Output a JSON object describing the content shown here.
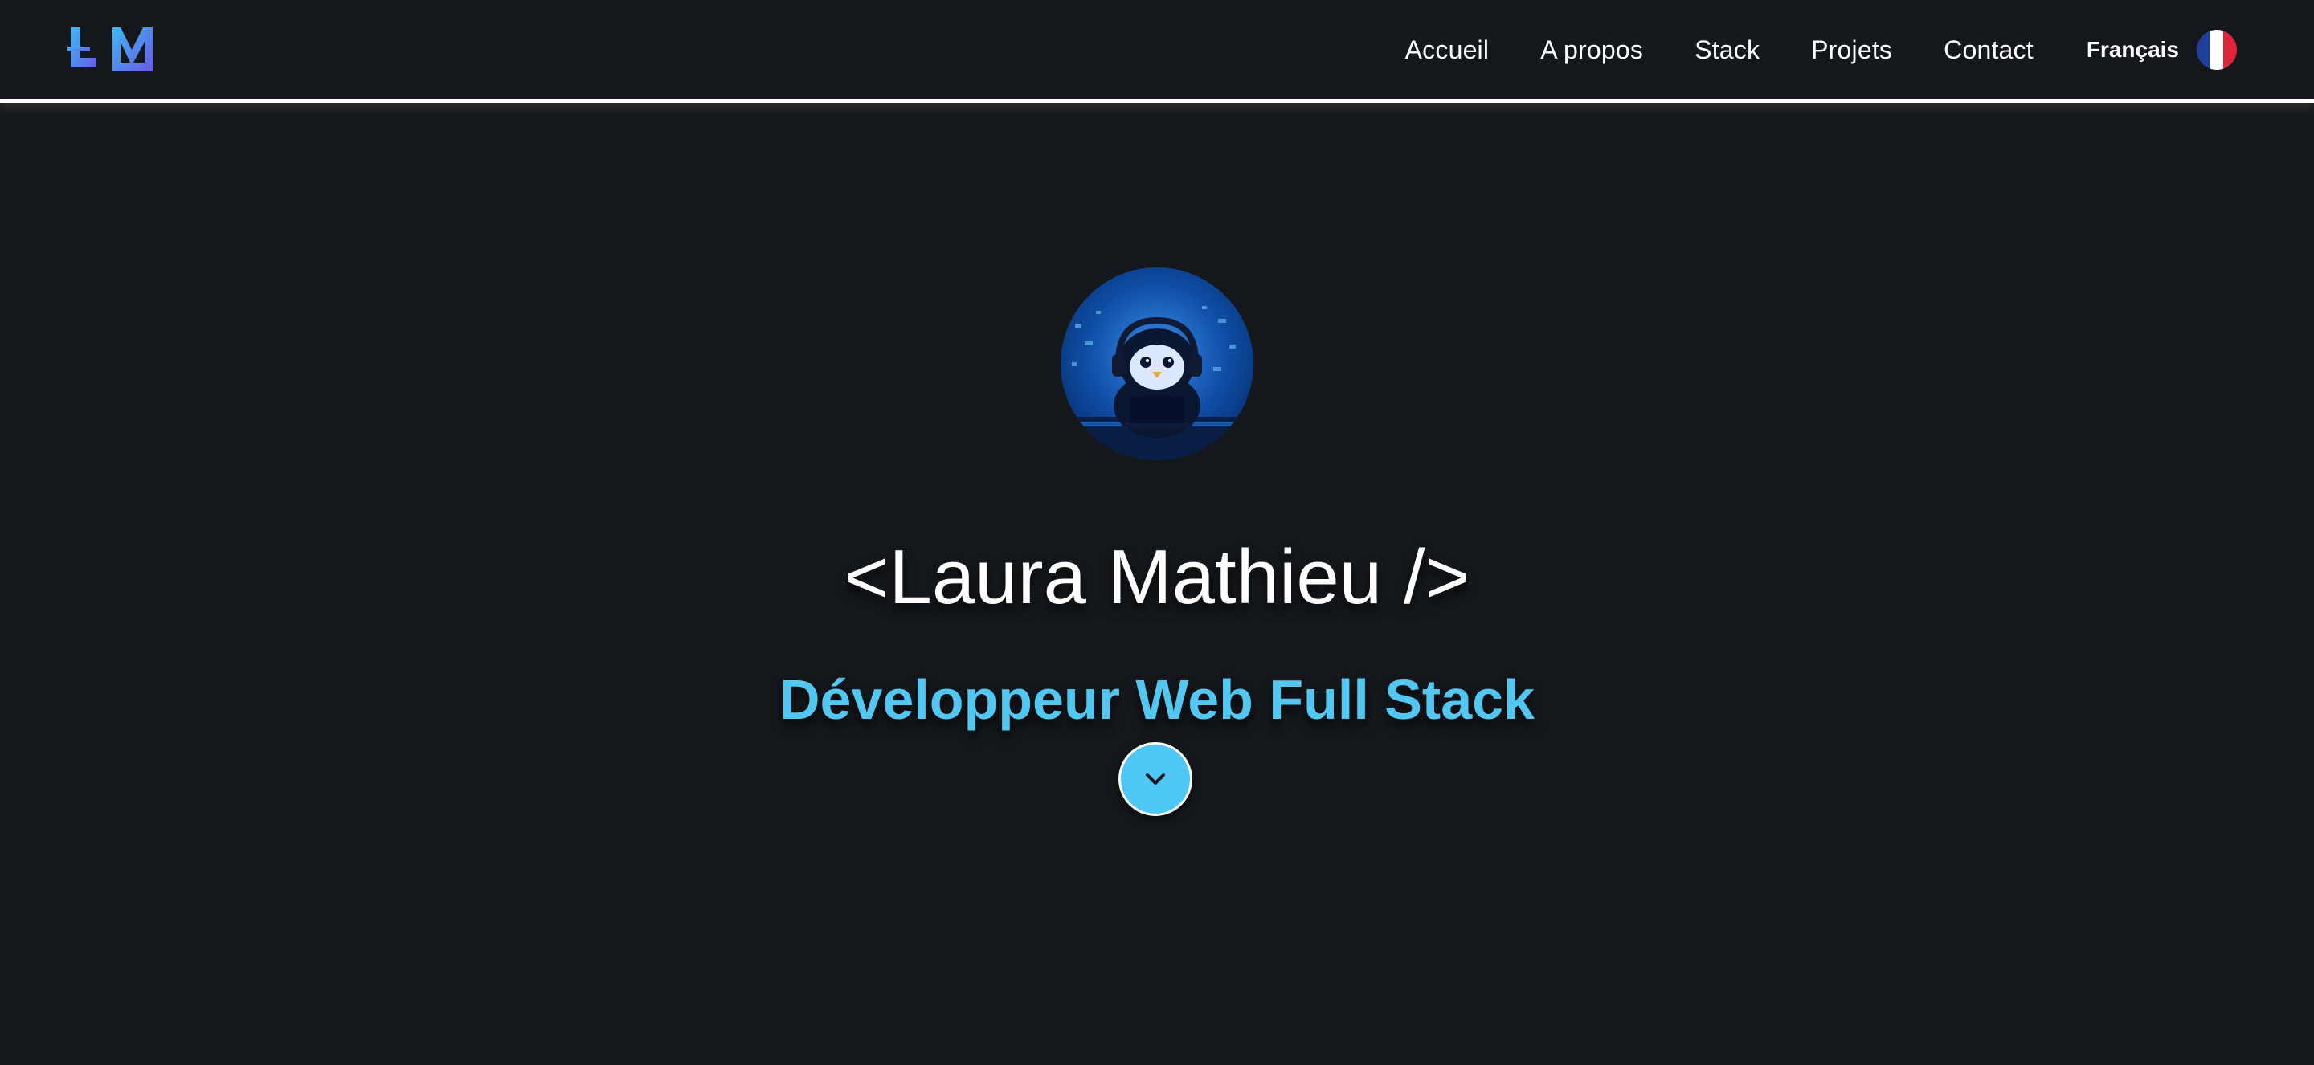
{
  "header": {
    "logo_text": "LM",
    "nav": [
      {
        "label": "Accueil"
      },
      {
        "label": "A propos"
      },
      {
        "label": "Stack"
      },
      {
        "label": "Projets"
      },
      {
        "label": "Contact"
      }
    ],
    "language": {
      "label": "Français",
      "flag_icon": "france-flag-icon"
    }
  },
  "hero": {
    "avatar_icon": "penguin-with-headphones-avatar",
    "name": "<Laura Mathieu />",
    "role": "Développeur Web Full Stack",
    "scroll_icon": "chevron-down-icon"
  },
  "colors": {
    "background": "#14171b",
    "accent": "#52c7f2",
    "text": "#ffffff",
    "logo_gradient_start": "#6a5be8",
    "logo_gradient_end": "#3fb8f0",
    "flag_blue": "#1f3f9a",
    "flag_white": "#ffffff",
    "flag_red": "#e0243a"
  }
}
